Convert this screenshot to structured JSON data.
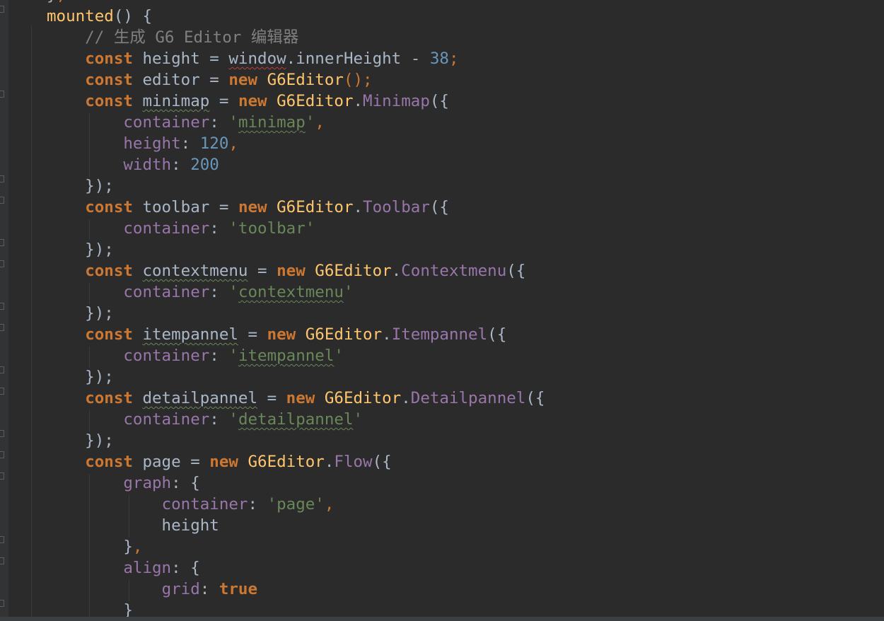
{
  "code_lines": [
    {
      "parts": [
        {
          "t": "}",
          "c": "plain"
        },
        {
          "t": ",",
          "c": "punc"
        }
      ]
    },
    {
      "parts": [
        {
          "t": "mounted",
          "c": "fn"
        },
        {
          "t": "() {",
          "c": "plain"
        }
      ]
    },
    {
      "parts": [
        {
          "t": "    // 生成 G6 Editor 编辑器",
          "c": "cmt"
        }
      ]
    },
    {
      "parts": [
        {
          "t": "    ",
          "c": "plain"
        },
        {
          "t": "const",
          "c": "kw"
        },
        {
          "t": " height = ",
          "c": "plain"
        },
        {
          "t": "window",
          "c": "squig-red-plain"
        },
        {
          "t": ".innerHeight - ",
          "c": "plain"
        },
        {
          "t": "38",
          "c": "num"
        },
        {
          "t": ";",
          "c": "punc"
        }
      ]
    },
    {
      "parts": [
        {
          "t": "    ",
          "c": "plain"
        },
        {
          "t": "const",
          "c": "kw"
        },
        {
          "t": " editor = ",
          "c": "plain"
        },
        {
          "t": "new",
          "c": "kw"
        },
        {
          "t": " G6Editor",
          "c": "fn"
        },
        {
          "t": "();",
          "c": "punc"
        }
      ]
    },
    {
      "parts": [
        {
          "t": "    ",
          "c": "plain"
        },
        {
          "t": "const",
          "c": "kw"
        },
        {
          "t": " ",
          "c": "plain"
        },
        {
          "t": "minimap",
          "c": "squig-plain"
        },
        {
          "t": " = ",
          "c": "plain"
        },
        {
          "t": "new",
          "c": "kw"
        },
        {
          "t": " G6Editor",
          "c": "fn"
        },
        {
          "t": ".",
          "c": "plain"
        },
        {
          "t": "Minimap",
          "c": "prop"
        },
        {
          "t": "({",
          "c": "plain"
        }
      ]
    },
    {
      "parts": [
        {
          "t": "        ",
          "c": "plain"
        },
        {
          "t": "container",
          "c": "prop"
        },
        {
          "t": ": ",
          "c": "plain"
        },
        {
          "t": "'",
          "c": "str"
        },
        {
          "t": "minimap",
          "c": "squig-str"
        },
        {
          "t": "'",
          "c": "str"
        },
        {
          "t": ",",
          "c": "punc"
        }
      ]
    },
    {
      "parts": [
        {
          "t": "        ",
          "c": "plain"
        },
        {
          "t": "height",
          "c": "prop"
        },
        {
          "t": ": ",
          "c": "plain"
        },
        {
          "t": "120",
          "c": "num"
        },
        {
          "t": ",",
          "c": "punc"
        }
      ]
    },
    {
      "parts": [
        {
          "t": "        ",
          "c": "plain"
        },
        {
          "t": "width",
          "c": "prop"
        },
        {
          "t": ": ",
          "c": "plain"
        },
        {
          "t": "200",
          "c": "num"
        }
      ]
    },
    {
      "parts": [
        {
          "t": "    });",
          "c": "plain"
        }
      ]
    },
    {
      "parts": [
        {
          "t": "    ",
          "c": "plain"
        },
        {
          "t": "const",
          "c": "kw"
        },
        {
          "t": " toolbar = ",
          "c": "plain"
        },
        {
          "t": "new",
          "c": "kw"
        },
        {
          "t": " G6Editor",
          "c": "fn"
        },
        {
          "t": ".",
          "c": "plain"
        },
        {
          "t": "Toolbar",
          "c": "prop"
        },
        {
          "t": "({",
          "c": "plain"
        }
      ]
    },
    {
      "parts": [
        {
          "t": "        ",
          "c": "plain"
        },
        {
          "t": "container",
          "c": "prop"
        },
        {
          "t": ": ",
          "c": "plain"
        },
        {
          "t": "'toolbar'",
          "c": "str"
        }
      ]
    },
    {
      "parts": [
        {
          "t": "    });",
          "c": "plain"
        }
      ]
    },
    {
      "parts": [
        {
          "t": "    ",
          "c": "plain"
        },
        {
          "t": "const",
          "c": "kw"
        },
        {
          "t": " ",
          "c": "plain"
        },
        {
          "t": "contextmenu",
          "c": "squig-plain"
        },
        {
          "t": " = ",
          "c": "plain"
        },
        {
          "t": "new",
          "c": "kw"
        },
        {
          "t": " G6Editor",
          "c": "fn"
        },
        {
          "t": ".",
          "c": "plain"
        },
        {
          "t": "Contextmenu",
          "c": "prop"
        },
        {
          "t": "({",
          "c": "plain"
        }
      ]
    },
    {
      "parts": [
        {
          "t": "        ",
          "c": "plain"
        },
        {
          "t": "container",
          "c": "prop"
        },
        {
          "t": ": ",
          "c": "plain"
        },
        {
          "t": "'",
          "c": "str"
        },
        {
          "t": "contextmenu",
          "c": "squig-str"
        },
        {
          "t": "'",
          "c": "str"
        }
      ]
    },
    {
      "parts": [
        {
          "t": "    });",
          "c": "plain"
        }
      ]
    },
    {
      "parts": [
        {
          "t": "    ",
          "c": "plain"
        },
        {
          "t": "const",
          "c": "kw"
        },
        {
          "t": " ",
          "c": "plain"
        },
        {
          "t": "itempannel",
          "c": "squig-plain"
        },
        {
          "t": " = ",
          "c": "plain"
        },
        {
          "t": "new",
          "c": "kw"
        },
        {
          "t": " G6Editor",
          "c": "fn"
        },
        {
          "t": ".",
          "c": "plain"
        },
        {
          "t": "Itempannel",
          "c": "prop"
        },
        {
          "t": "({",
          "c": "plain"
        }
      ]
    },
    {
      "parts": [
        {
          "t": "        ",
          "c": "plain"
        },
        {
          "t": "container",
          "c": "prop"
        },
        {
          "t": ": ",
          "c": "plain"
        },
        {
          "t": "'",
          "c": "str"
        },
        {
          "t": "itempannel",
          "c": "squig-str"
        },
        {
          "t": "'",
          "c": "str"
        }
      ]
    },
    {
      "parts": [
        {
          "t": "    });",
          "c": "plain"
        }
      ]
    },
    {
      "parts": [
        {
          "t": "    ",
          "c": "plain"
        },
        {
          "t": "const",
          "c": "kw"
        },
        {
          "t": " ",
          "c": "plain"
        },
        {
          "t": "detailpannel",
          "c": "squig-plain"
        },
        {
          "t": " = ",
          "c": "plain"
        },
        {
          "t": "new",
          "c": "kw"
        },
        {
          "t": " G6Editor",
          "c": "fn"
        },
        {
          "t": ".",
          "c": "plain"
        },
        {
          "t": "Detailpannel",
          "c": "prop"
        },
        {
          "t": "({",
          "c": "plain"
        }
      ]
    },
    {
      "parts": [
        {
          "t": "        ",
          "c": "plain"
        },
        {
          "t": "container",
          "c": "prop"
        },
        {
          "t": ": ",
          "c": "plain"
        },
        {
          "t": "'",
          "c": "str"
        },
        {
          "t": "detailpannel",
          "c": "squig-str"
        },
        {
          "t": "'",
          "c": "str"
        }
      ]
    },
    {
      "parts": [
        {
          "t": "    });",
          "c": "plain"
        }
      ]
    },
    {
      "parts": [
        {
          "t": "    ",
          "c": "plain"
        },
        {
          "t": "const",
          "c": "kw"
        },
        {
          "t": " page = ",
          "c": "plain"
        },
        {
          "t": "new",
          "c": "kw"
        },
        {
          "t": " G6Editor",
          "c": "fn"
        },
        {
          "t": ".",
          "c": "plain"
        },
        {
          "t": "Flow",
          "c": "prop"
        },
        {
          "t": "({",
          "c": "plain"
        }
      ]
    },
    {
      "parts": [
        {
          "t": "        ",
          "c": "plain"
        },
        {
          "t": "graph",
          "c": "prop"
        },
        {
          "t": ": {",
          "c": "plain"
        }
      ]
    },
    {
      "parts": [
        {
          "t": "            ",
          "c": "plain"
        },
        {
          "t": "container",
          "c": "prop"
        },
        {
          "t": ": ",
          "c": "plain"
        },
        {
          "t": "'page'",
          "c": "str"
        },
        {
          "t": ",",
          "c": "punc"
        }
      ]
    },
    {
      "parts": [
        {
          "t": "            height",
          "c": "plain"
        }
      ]
    },
    {
      "parts": [
        {
          "t": "        }",
          "c": "plain"
        },
        {
          "t": ",",
          "c": "punc"
        }
      ]
    },
    {
      "parts": [
        {
          "t": "        ",
          "c": "plain"
        },
        {
          "t": "align",
          "c": "prop"
        },
        {
          "t": ": {",
          "c": "plain"
        }
      ]
    },
    {
      "parts": [
        {
          "t": "            ",
          "c": "plain"
        },
        {
          "t": "grid",
          "c": "prop"
        },
        {
          "t": ": ",
          "c": "plain"
        },
        {
          "t": "true",
          "c": "kw"
        }
      ]
    },
    {
      "parts": [
        {
          "t": "        }",
          "c": "plain"
        }
      ]
    }
  ],
  "colors": {
    "background": "#2b2b2b",
    "keyword": "#cc7832",
    "function": "#ffc66d",
    "property": "#9876aa",
    "string": "#6a8759",
    "number": "#6897bb",
    "comment": "#808080",
    "text": "#a9b7c6"
  }
}
